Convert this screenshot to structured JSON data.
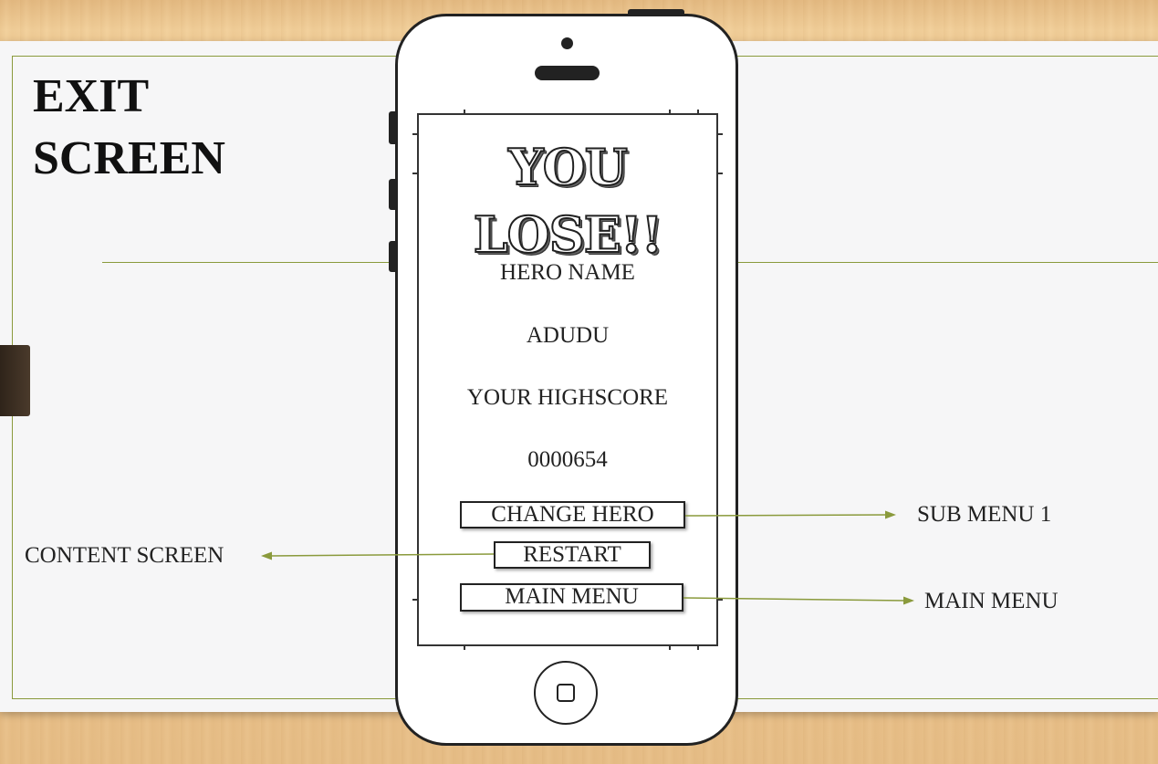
{
  "slide": {
    "title_line1": "EXIT",
    "title_line2": "SCREEN"
  },
  "phone_screen": {
    "headline_line1": "YOU",
    "headline_line2": "LOSE!!",
    "hero_label": "HERO NAME",
    "hero_value": "ADUDU",
    "score_label": "YOUR HIGHSCORE",
    "score_value": "0000654",
    "buttons": {
      "change_hero": "CHANGE HERO",
      "restart": "RESTART",
      "main_menu": "MAIN MENU"
    }
  },
  "callouts": {
    "sub_menu": "SUB MENU 1",
    "content_screen": "CONTENT SCREEN",
    "main_menu": "MAIN MENU"
  },
  "colors": {
    "accent_line": "#8a9a3c",
    "wood": "#eec893",
    "slide_bg": "#f6f6f7"
  }
}
